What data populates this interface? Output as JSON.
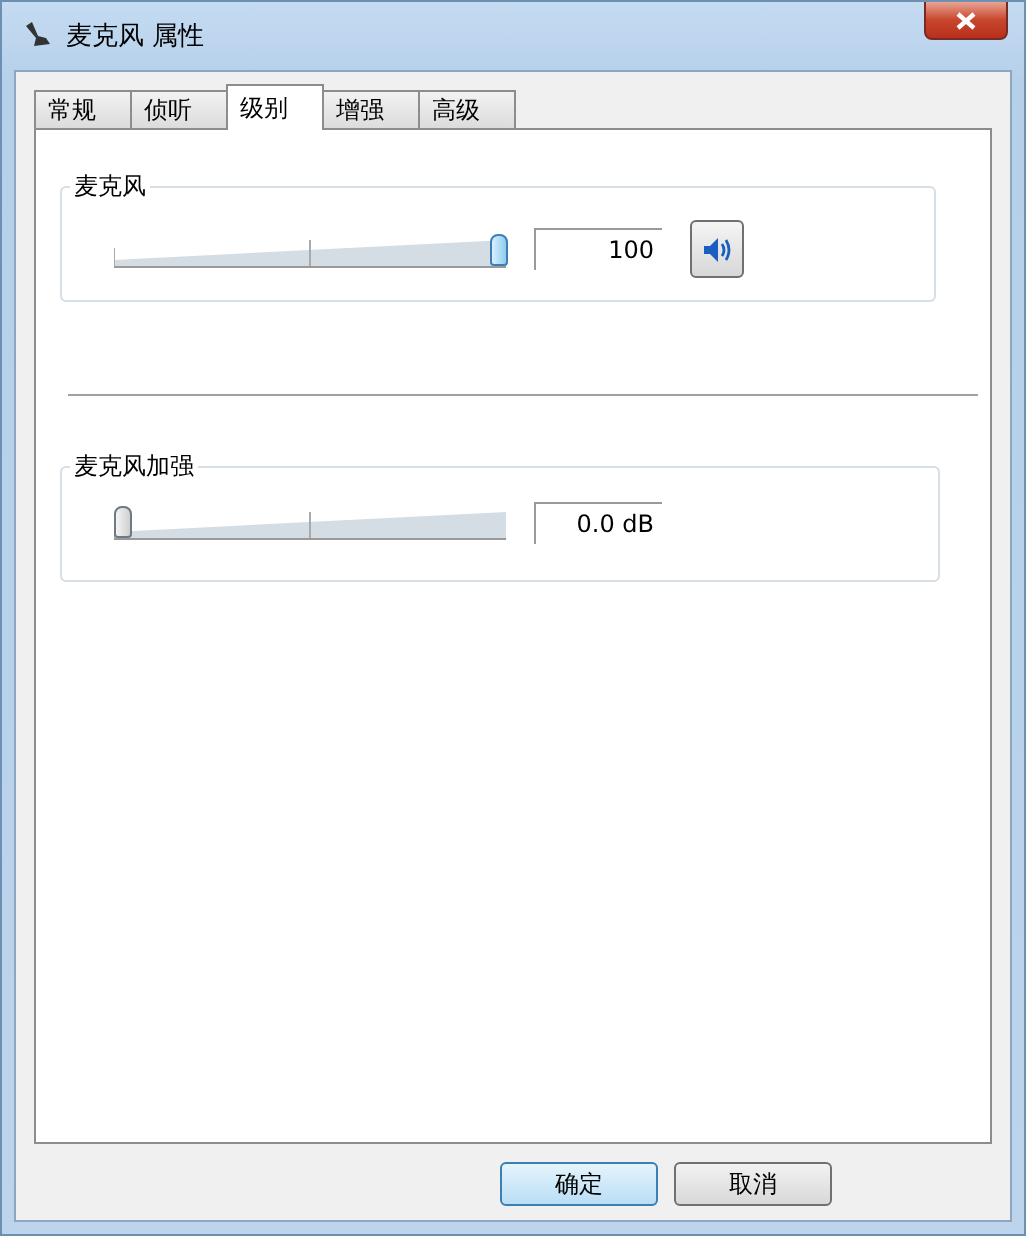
{
  "window": {
    "title": "麦克风 属性"
  },
  "tabs": [
    {
      "label": "常规",
      "selected": false
    },
    {
      "label": "侦听",
      "selected": false
    },
    {
      "label": "级别",
      "selected": true
    },
    {
      "label": "增强",
      "selected": false
    },
    {
      "label": "高级",
      "selected": false
    }
  ],
  "levels": [
    {
      "label": "麦克风",
      "level": 1,
      "reading": "100",
      "mute_button": true
    },
    {
      "label": "麦克风加强",
      "level": 0,
      "reading": "0.0 dB",
      "mute_button": false
    }
  ],
  "buttons": [
    {
      "label": "确定",
      "default": true
    },
    {
      "label": "取消",
      "default": false
    }
  ]
}
